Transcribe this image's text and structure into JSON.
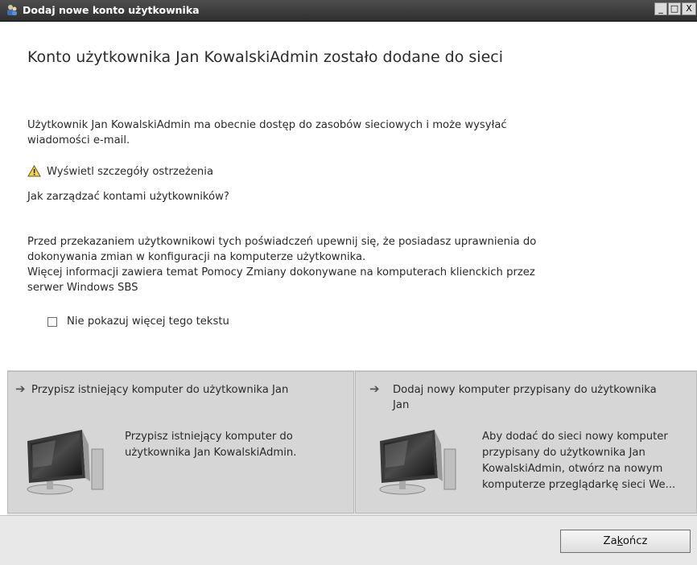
{
  "window": {
    "title": "Dodaj nowe konto użytkownika",
    "minimize_glyph": "_",
    "maximize_glyph": "□",
    "close_glyph": "X"
  },
  "main": {
    "heading": "Konto użytkownika Jan KowalskiAdmin zostało dodane do sieci",
    "info_line1": "Użytkownik Jan KowalskiAdmin ma obecnie dostęp do zasobów sieciowych i może wysyłać",
    "info_line2": "wiadomości e-mail.",
    "warning_link": "Wyświetl szczegóły ostrzeżenia",
    "manage_link": "Jak zarządzać kontami użytkowników?",
    "notice_line1": "Przed przekazaniem użytkownikowi tych poświadczeń upewnij się, że posiadasz uprawnienia do",
    "notice_line2": "dokonywania zmian w konfiguracji na komputerze użytkownika.",
    "notice_line3": "Więcej informacji zawiera temat Pomocy Zmiany dokonywane na komputerach klienckich przez",
    "notice_line4": "serwer Windows SBS",
    "checkbox_label": "Nie pokazuj więcej tego tekstu",
    "checkbox_checked": false
  },
  "tasks": [
    {
      "title": "Przypisz istniejący komputer do użytkownika Jan",
      "desc": [
        "Przypisz istniejący komputer do",
        "użytkownika Jan KowalskiAdmin."
      ]
    },
    {
      "title_line1": "Dodaj nowy komputer przypisany do użytkownika",
      "title_line2": "Jan",
      "desc": [
        "Aby dodać do sieci nowy komputer",
        "przypisany do użytkownika Jan",
        "KowalskiAdmin, otwórz na nowym",
        "komputerze przeglądarkę sieci We..."
      ]
    }
  ],
  "footer": {
    "finish_label_pre": "Za",
    "finish_label_accel": "k",
    "finish_label_post": "ończ"
  },
  "icons": {
    "app": "users-icon",
    "warning": "warning-icon",
    "task_arrow": "arrow-right-icon",
    "monitor": "computer-monitor-icon"
  }
}
